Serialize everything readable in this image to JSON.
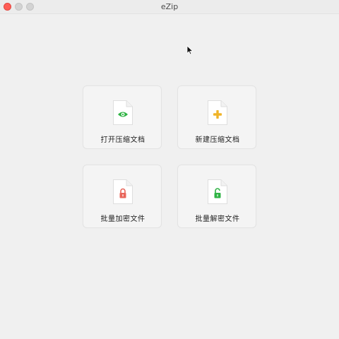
{
  "window": {
    "title": "eZip"
  },
  "actions": [
    {
      "label": "打开压缩文档",
      "icon": "eye-icon",
      "color": "#2fb344"
    },
    {
      "label": "新建压缩文档",
      "icon": "plus-icon",
      "color": "#f0b429"
    },
    {
      "label": "批量加密文件",
      "icon": "lock-icon",
      "color": "#e8655a"
    },
    {
      "label": "批量解密文件",
      "icon": "unlock-icon",
      "color": "#2fb344"
    }
  ]
}
